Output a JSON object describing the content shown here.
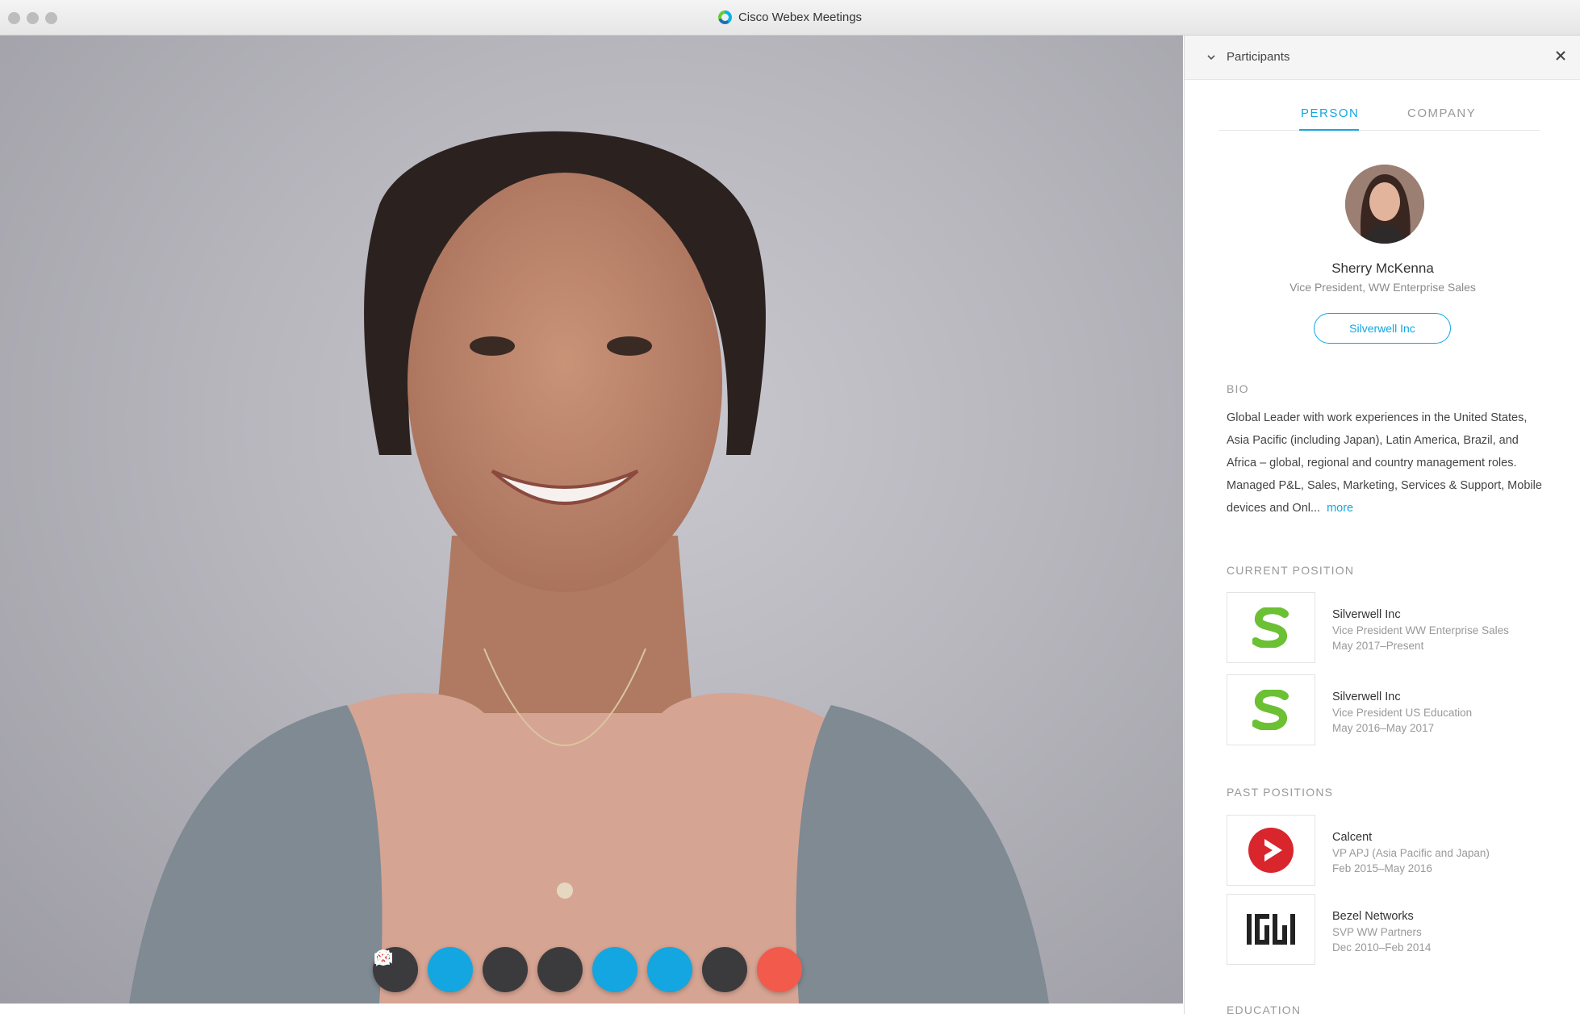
{
  "window": {
    "title": "Cisco Webex Meetings"
  },
  "controls": [
    {
      "name": "mute-button",
      "icon": "microphone-muted-icon",
      "style": "dark"
    },
    {
      "name": "video-button",
      "icon": "video-off-icon",
      "style": "blue"
    },
    {
      "name": "share-button",
      "icon": "upload-icon",
      "style": "dark"
    },
    {
      "name": "record-button",
      "icon": "record-icon",
      "style": "dark"
    },
    {
      "name": "participants-button",
      "icon": "participants-icon",
      "style": "blue"
    },
    {
      "name": "chat-button",
      "icon": "chat-icon",
      "style": "blue"
    },
    {
      "name": "more-button",
      "icon": "more-icon",
      "style": "dark"
    },
    {
      "name": "end-call-button",
      "icon": "close-icon",
      "style": "red"
    }
  ],
  "panel": {
    "title": "Participants",
    "tabs": {
      "person": "PERSON",
      "company": "COMPANY"
    },
    "profile": {
      "name": "Sherry McKenna",
      "title": "Vice President, WW Enterprise Sales",
      "company_button": "Silverwell Inc"
    },
    "bio": {
      "label": "BIO",
      "text": "Global Leader with work experiences in the United States, Asia Pacific (including Japan), Latin America, Brazil, and Africa – global, regional and country management roles. Managed P&L, Sales, Marketing, Services & Support, Mobile devices and Onl...",
      "more": "more"
    },
    "current_label": "CURRENT POSITION",
    "current": [
      {
        "company": "Silverwell Inc",
        "role": "Vice President WW Enterprise Sales",
        "dates": "May 2017–Present"
      },
      {
        "company": "Silverwell Inc",
        "role": "Vice President US Education",
        "dates": "May 2016–May 2017"
      }
    ],
    "past_label": "PAST POSITIONS",
    "past": [
      {
        "company": "Calcent",
        "role": "VP APJ (Asia Pacific and Japan)",
        "dates": "Feb 2015–May 2016"
      },
      {
        "company": "Bezel Networks",
        "role": "SVP WW Partners",
        "dates": "Dec 2010–Feb 2014"
      }
    ],
    "education_label": "EDUCATION"
  },
  "colors": {
    "accent": "#13a6e0",
    "end_call": "#f25a4c",
    "control_dark": "#3b3b3d"
  }
}
